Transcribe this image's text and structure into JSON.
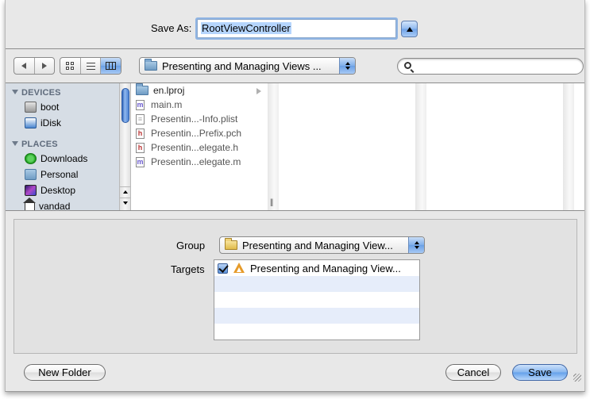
{
  "dialog": {
    "save_as_label": "Save As:",
    "save_as_value": "RootViewController",
    "expand_toggle": "collapse-up"
  },
  "toolbar": {
    "back_label": "Back",
    "forward_label": "Forward",
    "view_modes": [
      "icon",
      "list",
      "column"
    ],
    "active_view_mode": "column",
    "path_popup_value": "Presenting and Managing Views ...",
    "search_placeholder": ""
  },
  "sidebar": {
    "sections": [
      {
        "title": "DEVICES",
        "items": [
          {
            "label": "boot",
            "icon": "hard-disk-icon"
          },
          {
            "label": "iDisk",
            "icon": "idisk-icon"
          }
        ]
      },
      {
        "title": "PLACES",
        "items": [
          {
            "label": "Downloads",
            "icon": "downloads-icon"
          },
          {
            "label": "Personal",
            "icon": "folder-icon"
          },
          {
            "label": "Desktop",
            "icon": "desktop-icon"
          },
          {
            "label": "vandad",
            "icon": "home-icon"
          }
        ]
      }
    ]
  },
  "browser": {
    "column1": [
      {
        "name": "en.lproj",
        "type": "folder",
        "has_children": true
      },
      {
        "name": "main.m",
        "type": "m"
      },
      {
        "name": "Presentin...-Info.plist",
        "type": "plist"
      },
      {
        "name": "Presentin...Prefix.pch",
        "type": "h"
      },
      {
        "name": "Presentin...elegate.h",
        "type": "h"
      },
      {
        "name": "Presentin...elegate.m",
        "type": "m"
      }
    ]
  },
  "options": {
    "group_label": "Group",
    "group_value": "Presenting and Managing View...",
    "targets_label": "Targets",
    "targets": [
      {
        "label": "Presenting and Managing View...",
        "checked": true
      }
    ]
  },
  "buttons": {
    "new_folder": "New Folder",
    "cancel": "Cancel",
    "save": "Save"
  },
  "file_type_glyphs": {
    "m": "m",
    "h": "h",
    "plist": "≡"
  }
}
